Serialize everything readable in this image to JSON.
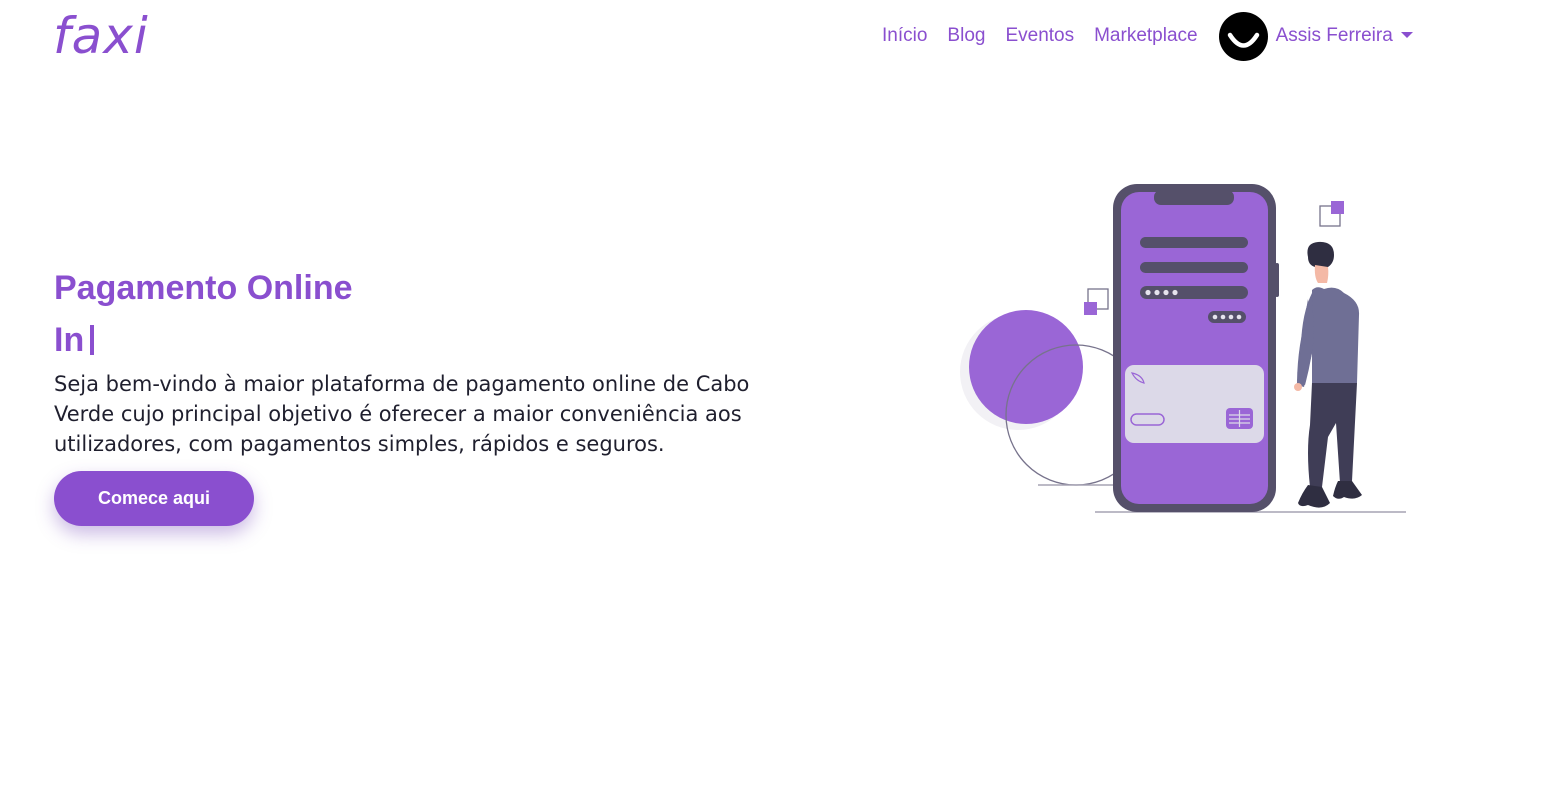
{
  "navbar": {
    "logo": "faxi",
    "links": [
      {
        "label": "Início"
      },
      {
        "label": "Blog"
      },
      {
        "label": "Eventos"
      },
      {
        "label": "Marketplace"
      }
    ],
    "user": {
      "name": "Assis Ferreira"
    }
  },
  "hero": {
    "title": "Pagamento Online",
    "typed_text": "In",
    "description": "Seja bem-vindo à maior plataforma de pagamento online de Cabo Verde cujo principal objetivo é oferecer a maior conveniência aos utilizadores, com pagamentos simples, rápidos e seguros.",
    "cta_label": "Comece aqui"
  },
  "colors": {
    "brand": "#8a4fcf",
    "text": "#1f1f2e",
    "phone_body": "#55506a",
    "phone_screen": "#9a66d6",
    "person_shirt": "#6f6f95"
  },
  "icons": {
    "avatar": "smiley-avatar-icon",
    "user_menu": "caret-down-icon",
    "hero_image": "mobile-payment-illustration"
  }
}
